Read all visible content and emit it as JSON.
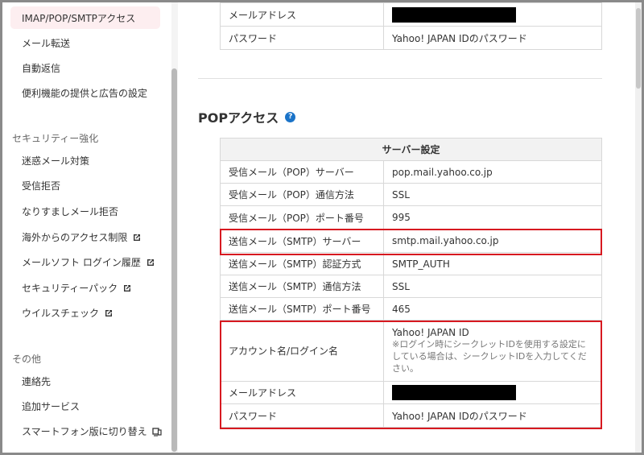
{
  "sidebar": {
    "items": [
      {
        "label": "IMAP/POP/SMTPアクセス",
        "active": true
      },
      {
        "label": "メール転送"
      },
      {
        "label": "自動返信"
      },
      {
        "label": "便利機能の提供と広告の設定"
      }
    ],
    "security_group": {
      "title": "セキュリティー強化",
      "items": [
        {
          "label": "迷惑メール対策"
        },
        {
          "label": "受信拒否"
        },
        {
          "label": "なりすましメール拒否"
        },
        {
          "label": "海外からのアクセス制限",
          "external": true
        },
        {
          "label": "メールソフト ログイン履歴",
          "external": true
        },
        {
          "label": "セキュリティーパック",
          "external": true
        },
        {
          "label": "ウイルスチェック",
          "external": true
        }
      ]
    },
    "other_group": {
      "title": "その他",
      "items": [
        {
          "label": "連絡先"
        },
        {
          "label": "追加サービス"
        },
        {
          "label": "スマートフォン版に切り替え",
          "icon": "phone-pc-icon"
        }
      ]
    }
  },
  "top_table": {
    "rows": [
      {
        "label": "メールアドレス",
        "value": ""
      },
      {
        "label": "パスワード",
        "value": "Yahoo! JAPAN IDのパスワード"
      }
    ]
  },
  "pop_section": {
    "title": "POPアクセス",
    "help_icon": "?",
    "table_header": "サーバー設定",
    "rows": [
      {
        "label": "受信メール（POP）サーバー",
        "value": "pop.mail.yahoo.co.jp"
      },
      {
        "label": "受信メール（POP）通信方法",
        "value": "SSL"
      },
      {
        "label": "受信メール（POP）ポート番号",
        "value": "995"
      },
      {
        "label": "送信メール（SMTP）サーバー",
        "value": "smtp.mail.yahoo.co.jp"
      },
      {
        "label": "送信メール（SMTP）認証方式",
        "value": "SMTP_AUTH"
      },
      {
        "label": "送信メール（SMTP）通信方法",
        "value": "SSL"
      },
      {
        "label": "送信メール（SMTP）ポート番号",
        "value": "465"
      }
    ],
    "account": {
      "label": "アカウント名/ログイン名",
      "value": "Yahoo! JAPAN ID",
      "note": "※ログイン時にシークレットIDを使用する設定にしている場合は、シークレットIDを入力してください。"
    },
    "email_label": "メールアドレス",
    "password_label": "パスワード",
    "password_value": "Yahoo! JAPAN IDのパスワード"
  },
  "colors": {
    "highlight_red": "#d71920",
    "active_bg": "#fdeef0",
    "help_blue": "#1a73c8"
  }
}
